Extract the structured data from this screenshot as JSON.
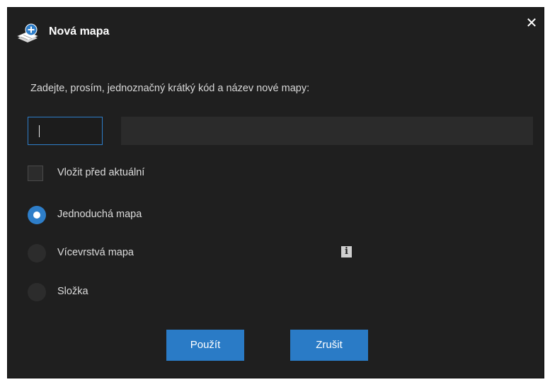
{
  "dialog": {
    "title": "Nová mapa",
    "close_label": "✕",
    "icon": "new-map-icon"
  },
  "prompt": "Zadejte, prosím, jednoznačný krátký kód a název nové mapy:",
  "code_field": {
    "value": "",
    "placeholder": ""
  },
  "name_field": {
    "value": "",
    "placeholder": ""
  },
  "checkbox": {
    "label": "Vložit před aktuální",
    "checked": false
  },
  "options": [
    {
      "label": "Jednoduchá mapa",
      "selected": true
    },
    {
      "label": "Vícevrstvá mapa",
      "selected": false
    },
    {
      "label": "Složka",
      "selected": false
    }
  ],
  "info_icon": {
    "glyph": "i",
    "icon": "info-icon"
  },
  "buttons": {
    "apply": "Použít",
    "cancel": "Zrušit"
  },
  "colors": {
    "background": "#1f1f1f",
    "accent": "#2a7bc6",
    "text": "#dcdcdc",
    "field": "#2b2b2b"
  }
}
